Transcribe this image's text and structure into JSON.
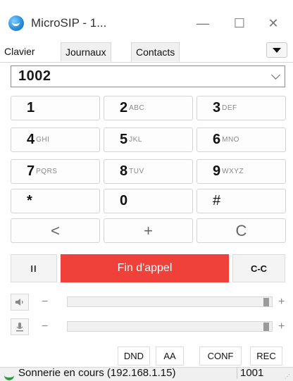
{
  "window": {
    "title": "MicroSIP - 1...",
    "minimize_glyph": "—",
    "maximize_glyph": "☐",
    "close_glyph": "✕"
  },
  "tabs": [
    {
      "label": "Clavier",
      "active": true
    },
    {
      "label": "Journaux",
      "active": false
    },
    {
      "label": "Contacts",
      "active": false
    }
  ],
  "dial": {
    "number": "1002"
  },
  "keypad": {
    "keys": [
      {
        "main": "1",
        "sub": ""
      },
      {
        "main": "2",
        "sub": "ABC"
      },
      {
        "main": "3",
        "sub": "DEF"
      },
      {
        "main": "4",
        "sub": "GHI"
      },
      {
        "main": "5",
        "sub": "JKL"
      },
      {
        "main": "6",
        "sub": "MNO"
      },
      {
        "main": "7",
        "sub": "PQRS"
      },
      {
        "main": "8",
        "sub": "TUV"
      },
      {
        "main": "9",
        "sub": "WXYZ"
      },
      {
        "main": "*",
        "sub": ""
      },
      {
        "main": "0",
        "sub": ""
      },
      {
        "main": "#",
        "sub": ""
      }
    ],
    "actions": [
      {
        "label": "<"
      },
      {
        "label": "+"
      },
      {
        "label": "C"
      }
    ]
  },
  "call": {
    "hold_label": "II",
    "hangup_label": "Fin d'appel",
    "transfer_label": "C-C",
    "hangup_color": "#f0403a"
  },
  "volume": {
    "minus": "−",
    "plus": "+",
    "speaker_level": 1.0,
    "mic_level": 1.0,
    "speaker_icon": "speaker-icon",
    "mic_icon": "microphone-icon"
  },
  "toggles": [
    {
      "label": "DND"
    },
    {
      "label": "AA"
    },
    {
      "label": "CONF"
    },
    {
      "label": "REC"
    }
  ],
  "status": {
    "text": "Sonnerie en cours (192.168.1.15)",
    "account": "1001"
  }
}
